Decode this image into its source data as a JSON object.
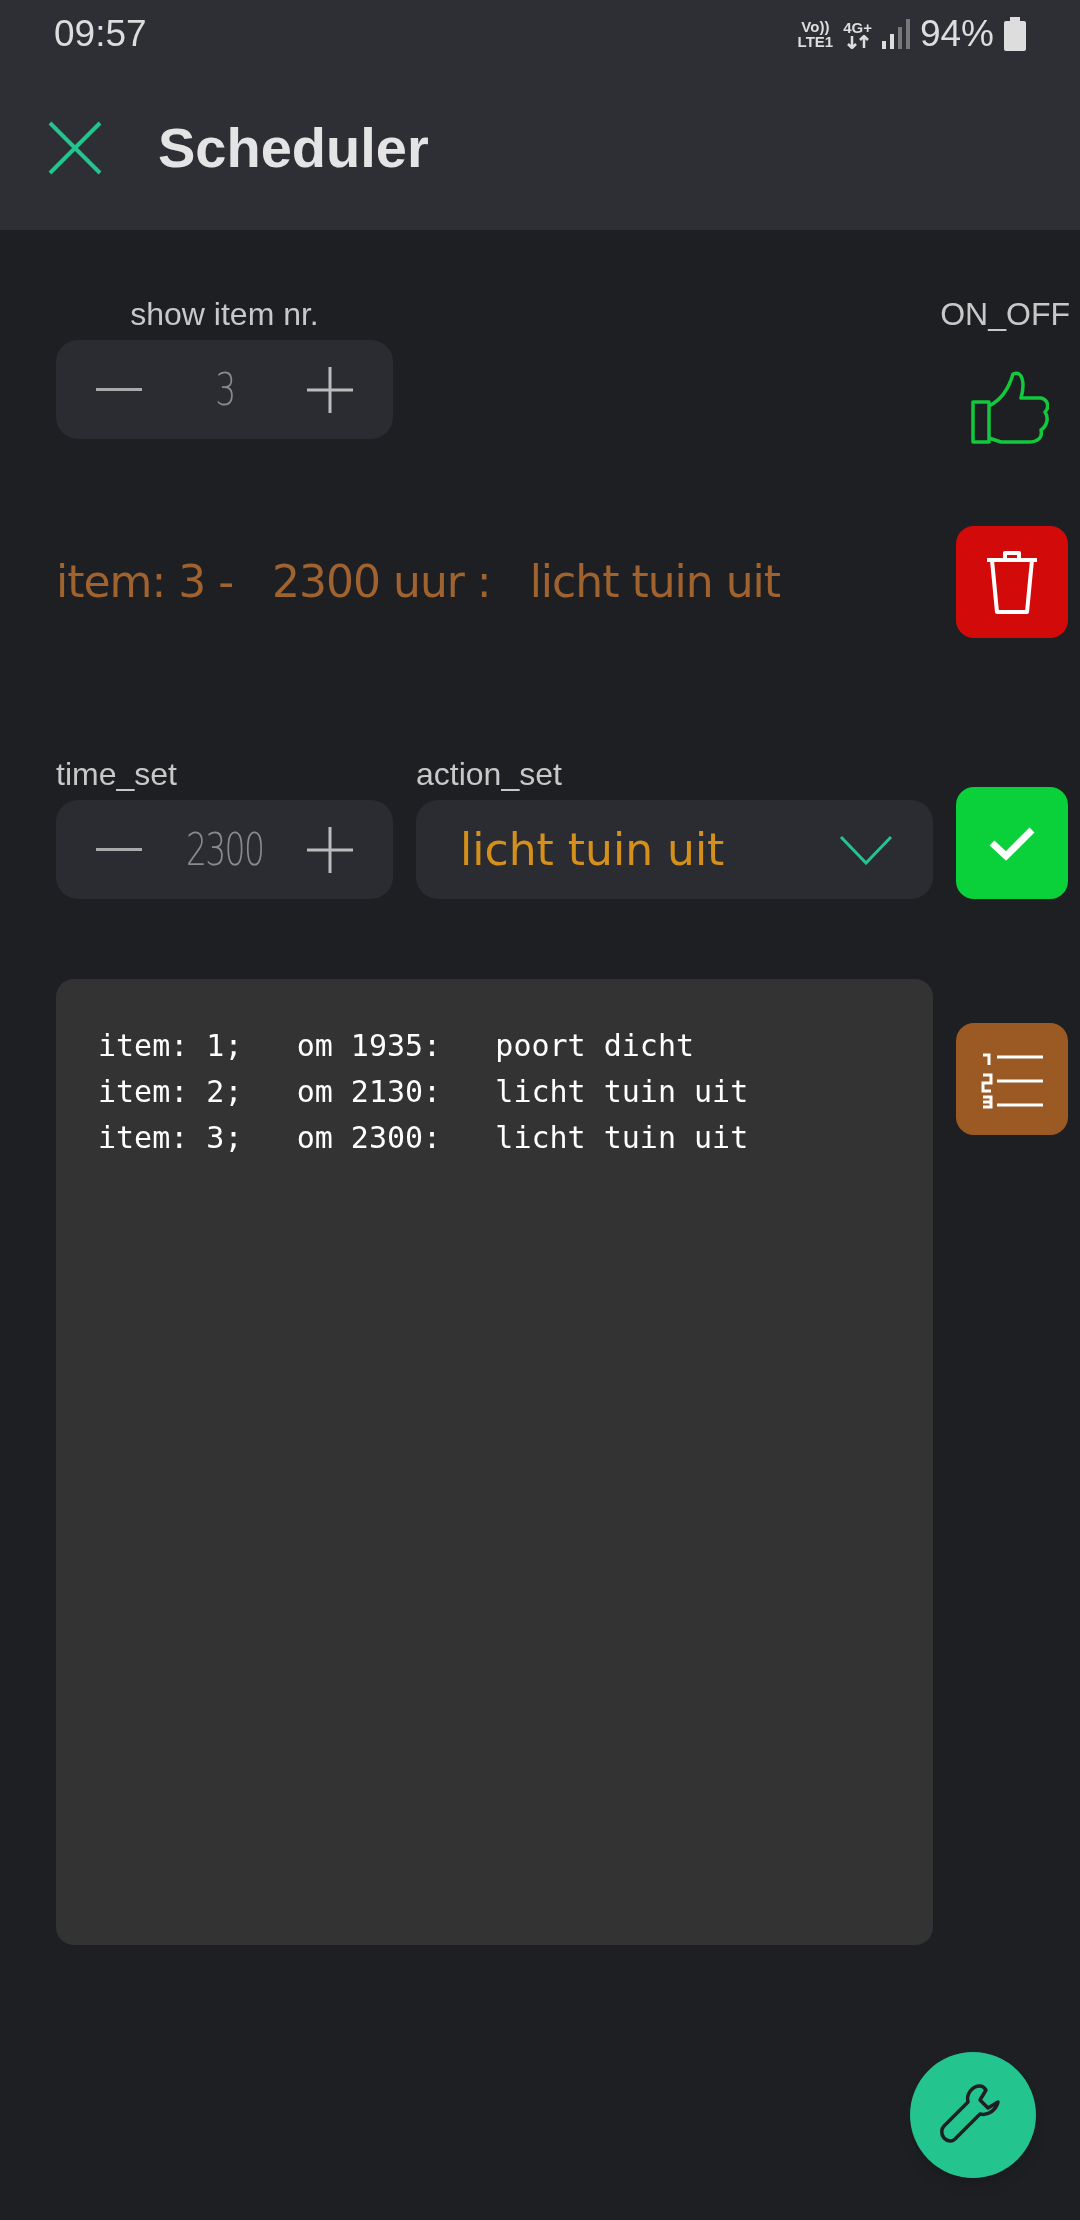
{
  "status_bar": {
    "time": "09:57",
    "volte": "Vo))",
    "lte": "LTE1",
    "network": "4G+",
    "battery": "94%"
  },
  "header": {
    "title": "Scheduler"
  },
  "item_stepper": {
    "label": "show item nr.",
    "value": "3"
  },
  "on_off": {
    "label": "ON_OFF",
    "on": true
  },
  "current_item": "item: 3 -   2300 uur :   licht tuin uit",
  "time_set": {
    "label": "time_set",
    "value": "2300"
  },
  "action_set": {
    "label": "action_set",
    "value": "licht tuin uit"
  },
  "terminal": {
    "lines": [
      "item: 1;   om 1935:   poort dicht",
      "item: 2;   om 2130:   licht tuin uit",
      "item: 3;   om 2300:   licht tuin uit"
    ]
  }
}
